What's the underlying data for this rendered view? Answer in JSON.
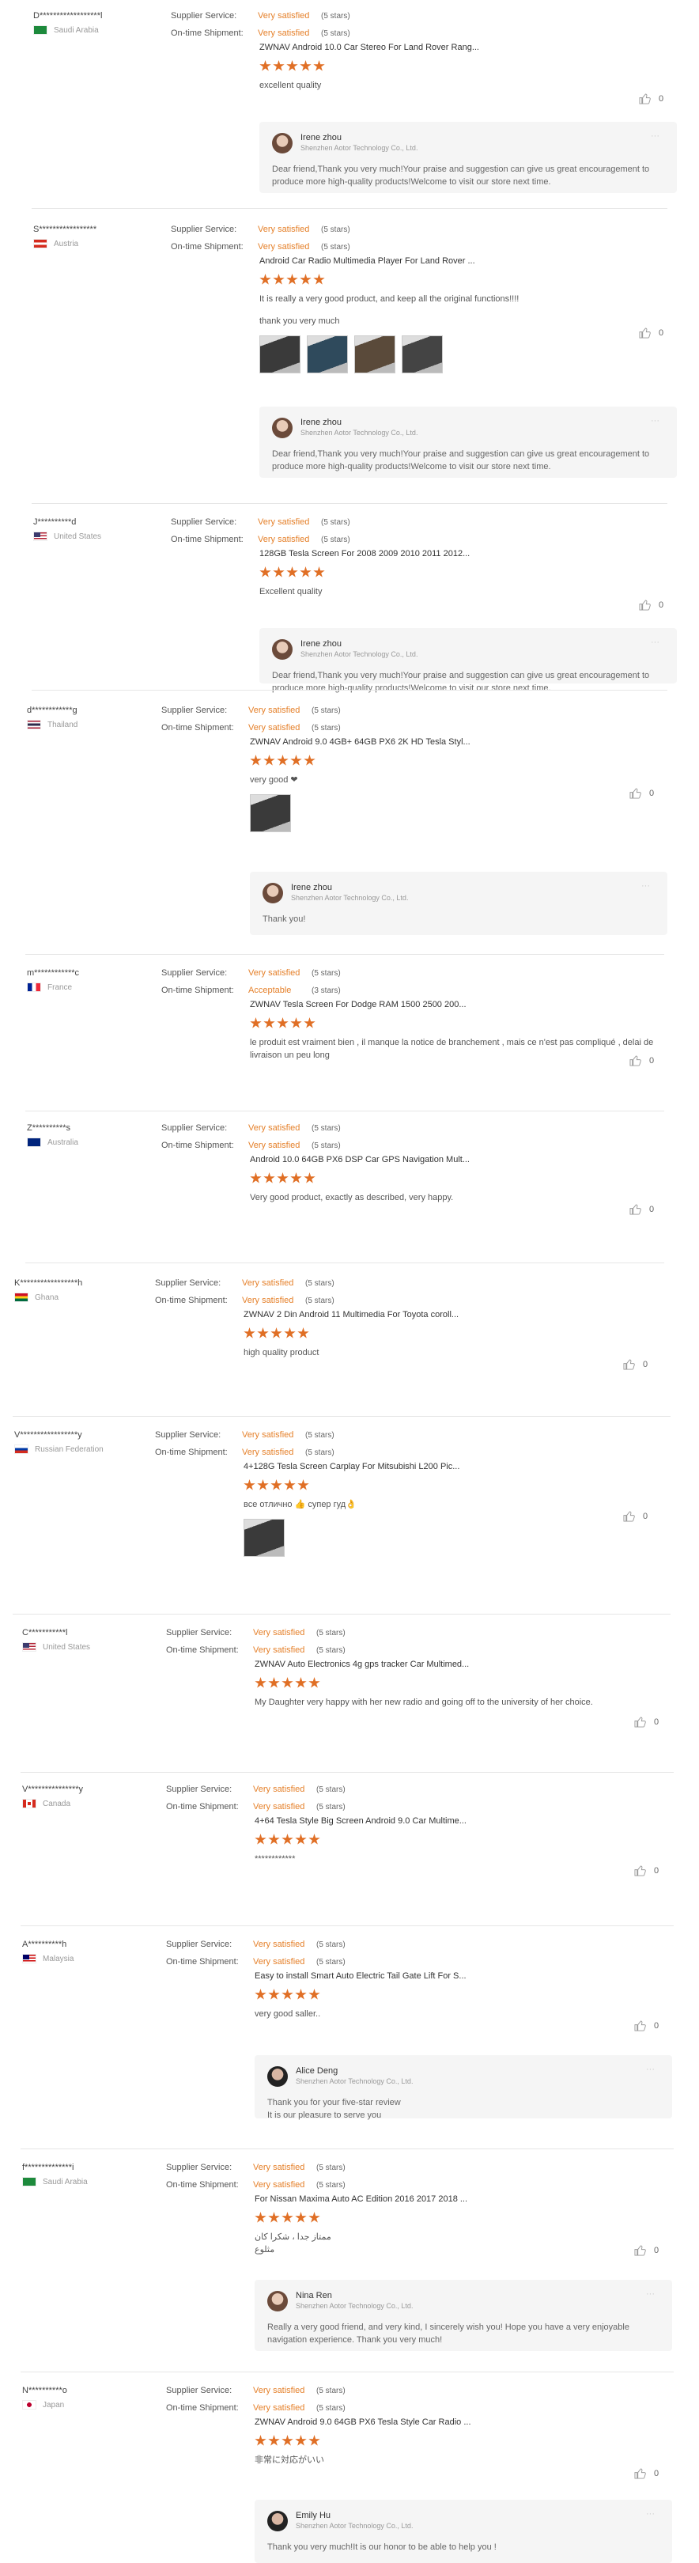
{
  "labels": {
    "supplier_service": "Supplier Service:",
    "ontime_shipment": "On-time Shipment:",
    "reply_company": "Shenzhen Aotor Technology Co., Ltd."
  },
  "colors": {
    "accent": "#e5802a",
    "star": "#e06f25",
    "reply_bg": "#f5f5f5"
  },
  "reviews": [
    {
      "user": "D******************l",
      "country": "Saudi Arabia",
      "flag": "sa",
      "supplier": "Very satisfied",
      "supplier_stars": "(5 stars)",
      "shipment": "Very satisfied",
      "shipment_stars": "(5 stars)",
      "product": "ZWNAV Android 10.0 Car Stereo For Land Rover Rang...",
      "rating": 5,
      "text": "excellent quality",
      "helpful": "0",
      "reply": {
        "name": "Irene zhou",
        "text": "Dear friend,Thank you very much!Your praise and suggestion can give us great encouragement to produce more high-quality products!Welcome to visit our store next time."
      }
    },
    {
      "user": "S*****************",
      "country": "Austria",
      "flag": "at",
      "supplier": "Very satisfied",
      "supplier_stars": "(5 stars)",
      "shipment": "Very satisfied",
      "shipment_stars": "(5 stars)",
      "product": "Android Car Radio Multimedia Player For Land Rover ...",
      "rating": 5,
      "text": "It is really a very good product, and keep all the original functions!!!!",
      "text2": "thank you very much",
      "helpful": "0",
      "reply": {
        "name": "Irene zhou",
        "text": "Dear friend,Thank you very much!Your praise and suggestion can give us great encouragement to produce more high-quality products!Welcome to visit our store next time."
      }
    },
    {
      "user": "J**********d",
      "country": "United States",
      "flag": "us",
      "supplier": "Very satisfied",
      "supplier_stars": "(5 stars)",
      "shipment": "Very satisfied",
      "shipment_stars": "(5 stars)",
      "product": "128GB Tesla Screen For 2008 2009 2010 2011 2012...",
      "rating": 5,
      "text": "Excellent quality",
      "helpful": "0",
      "reply": {
        "name": "Irene zhou",
        "text": "Dear friend,Thank you very much!Your praise and suggestion can give us great encouragement to produce more high-quality products!Welcome to visit our store next time."
      }
    },
    {
      "user": "d************g",
      "country": "Thailand",
      "flag": "th",
      "supplier": "Very satisfied",
      "supplier_stars": "(5 stars)",
      "shipment": "Very satisfied",
      "shipment_stars": "(5 stars)",
      "product": "ZWNAV Android 9.0 4GB+ 64GB PX6 2K HD Tesla Styl...",
      "rating": 5,
      "text": "very good ❤",
      "helpful": "0",
      "reply": {
        "name": "Irene zhou",
        "text": "Thank you!"
      }
    },
    {
      "user": "m************c",
      "country": "France",
      "flag": "fr",
      "supplier": "Very satisfied",
      "supplier_stars": "(5 stars)",
      "shipment": "Acceptable",
      "shipment_stars": "(3 stars)",
      "product": "ZWNAV Tesla Screen For Dodge RAM 1500 2500 200...",
      "rating": 5,
      "text": "le produit est vraiment bien , il manque la notice de branchement , mais ce n'est pas compliqué , delai de livraison un peu long",
      "helpful": "0"
    },
    {
      "user": "Z**********s",
      "country": "Australia",
      "flag": "au",
      "supplier": "Very satisfied",
      "supplier_stars": "(5 stars)",
      "shipment": "Very satisfied",
      "shipment_stars": "(5 stars)",
      "product": "Android 10.0 64GB PX6 DSP Car GPS Navigation Mult...",
      "rating": 5,
      "text": "Very good product, exactly as described, very happy.",
      "helpful": "0"
    },
    {
      "user": "K*****************h",
      "country": "Ghana",
      "flag": "gh",
      "supplier": "Very satisfied",
      "supplier_stars": "(5 stars)",
      "shipment": "Very satisfied",
      "shipment_stars": "(5 stars)",
      "product": "ZWNAV 2 Din Android 11 Multimedia For Toyota coroll...",
      "rating": 5,
      "text": "high quality product",
      "helpful": "0"
    },
    {
      "user": "V*****************y",
      "country": "Russian Federation",
      "flag": "ru",
      "supplier": "Very satisfied",
      "supplier_stars": "(5 stars)",
      "shipment": "Very satisfied",
      "shipment_stars": "(5 stars)",
      "product": "4+128G Tesla Screen Carplay For Mitsubishi L200 Pic...",
      "rating": 5,
      "text": "все отлично 👍 супер гуд👌",
      "helpful": "0"
    },
    {
      "user": "C***********l",
      "country": "United States",
      "flag": "us",
      "supplier": "Very satisfied",
      "supplier_stars": "(5 stars)",
      "shipment": "Very satisfied",
      "shipment_stars": "(5 stars)",
      "product": "ZWNAV Auto Electronics 4g gps tracker Car Multimed...",
      "rating": 5,
      "text": "My Daughter very happy with her new radio and going off to the university of her choice.",
      "helpful": "0"
    },
    {
      "user": "V***************y",
      "country": "Canada",
      "flag": "ca",
      "supplier": "Very satisfied",
      "supplier_stars": "(5 stars)",
      "shipment": "Very satisfied",
      "shipment_stars": "(5 stars)",
      "product": "4+64 Tesla Style Big Screen Android 9.0 Car Multime...",
      "rating": 5,
      "text": "************",
      "helpful": "0"
    },
    {
      "user": "A**********h",
      "country": "Malaysia",
      "flag": "my",
      "supplier": "Very satisfied",
      "supplier_stars": "(5 stars)",
      "shipment": "Very satisfied",
      "shipment_stars": "(5 stars)",
      "product": "Easy to install Smart Auto Electric Tail Gate Lift For S...",
      "rating": 5,
      "text": "very good saller..",
      "helpful": "0",
      "reply": {
        "name": "Alice Deng",
        "text": "Thank you for your five-star review\nIt is our pleasure to serve you"
      }
    },
    {
      "user": "f**************i",
      "country": "Saudi Arabia",
      "flag": "sa",
      "supplier": "Very satisfied",
      "supplier_stars": "(5 stars)",
      "shipment": "Very satisfied",
      "shipment_stars": "(5 stars)",
      "product": "For Nissan Maxima Auto AC Edition 2016 2017 2018 ...",
      "rating": 5,
      "text": "ممتاز جدا ، شكرا كان مثلوع",
      "helpful": "0",
      "reply": {
        "name": "Nina Ren",
        "text": "Really a very good friend, and very kind, I sincerely wish you! Hope you have a very enjoyable navigation experience. Thank you very much!"
      }
    },
    {
      "user": "N**********o",
      "country": "Japan",
      "flag": "jp",
      "supplier": "Very satisfied",
      "supplier_stars": "(5 stars)",
      "shipment": "Very satisfied",
      "shipment_stars": "(5 stars)",
      "product": "ZWNAV Android 9.0 64GB PX6 Tesla Style Car Radio ...",
      "rating": 5,
      "text": "非常に対応がいい",
      "helpful": "0",
      "reply": {
        "name": "Emily Hu",
        "text": "Thank you very much!It is our honor to be able to help you !"
      }
    }
  ]
}
